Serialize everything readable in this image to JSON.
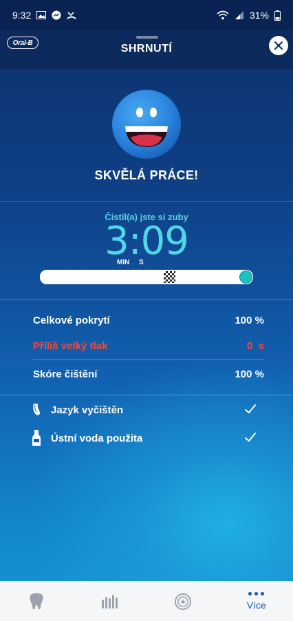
{
  "status_bar": {
    "time": "9:32",
    "battery": "31%"
  },
  "header": {
    "logo_text": "Oral-B",
    "title": "SHRNUTÍ"
  },
  "summary": {
    "headline": "SKVĚLÁ PRÁCE!",
    "brushed_label": "Čistil(a) jste si zuby",
    "time_display": "3:09",
    "unit_min": "MIN",
    "unit_s": "S",
    "progress_fraction": 1.0
  },
  "stats": [
    {
      "label": "Celkové pokrytí",
      "value": "100 %"
    },
    {
      "label": "Příliš velký tlak",
      "value": "0  s"
    },
    {
      "label": "Skóre čištění",
      "value": "100 %"
    }
  ],
  "checks": [
    {
      "label": "Jazyk vyčištěn",
      "icon": "tongue-icon",
      "checked": true
    },
    {
      "label": "Ústní voda použita",
      "icon": "mouthwash-icon",
      "checked": true
    }
  ],
  "bottom_nav": [
    {
      "icon": "tooth-icon",
      "label": ""
    },
    {
      "icon": "bar-chart-icon",
      "label": ""
    },
    {
      "icon": "award-badge-icon",
      "label": ""
    },
    {
      "icon": "more-dots-icon",
      "label": "Více"
    }
  ],
  "colors": {
    "accent_teal": "#4fd8e6",
    "warning_red": "#f24c3c",
    "nav_active": "#1a5cae"
  }
}
